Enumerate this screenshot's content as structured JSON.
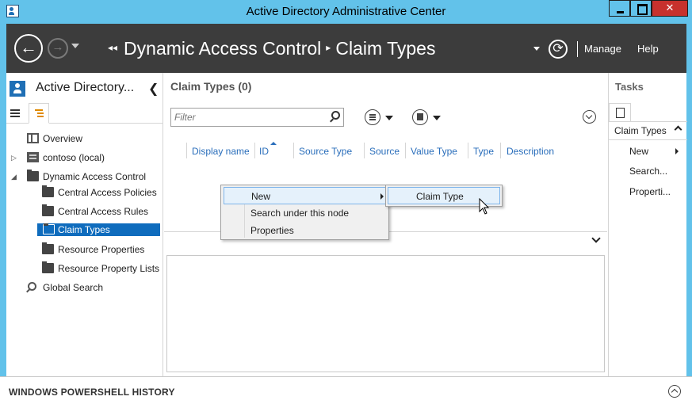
{
  "window": {
    "title": "Active Directory Administrative Center"
  },
  "header": {
    "breadcrumb": [
      "Dynamic Access Control",
      "Claim Types"
    ],
    "manage_label": "Manage",
    "help_label": "Help",
    "icons": [
      "back-arrow-icon",
      "forward-arrow-icon",
      "refresh-icon"
    ]
  },
  "left_nav": {
    "title": "Active Directory...",
    "tree": [
      {
        "label": "Overview",
        "icon": "overview-icon"
      },
      {
        "label": "contoso (local)",
        "icon": "server-icon",
        "expander": "▷"
      },
      {
        "label": "Dynamic Access Control",
        "icon": "folder-icon",
        "expander": "◢"
      },
      {
        "label": "Central Access Policies",
        "icon": "folder-icon"
      },
      {
        "label": "Central Access Rules",
        "icon": "folder-icon"
      },
      {
        "label": "Claim Types",
        "icon": "folder-icon",
        "selected": true
      },
      {
        "label": "Resource Properties",
        "icon": "folder-icon"
      },
      {
        "label": "Resource Property Lists",
        "icon": "folder-icon"
      },
      {
        "label": "Global Search",
        "icon": "search-icon"
      }
    ]
  },
  "center": {
    "title": "Claim Types  (0)",
    "filter_placeholder": "Filter",
    "columns": [
      "Display name",
      "ID",
      "Source Type",
      "Source",
      "Value Type",
      "Type",
      "Description"
    ]
  },
  "context_menu": {
    "items": [
      "New",
      "Search under this node",
      "Properties"
    ],
    "submenu": [
      "Claim Type"
    ]
  },
  "tasks": {
    "title": "Tasks",
    "group": "Claim Types",
    "items": [
      "New",
      "Search...",
      "Properti..."
    ]
  },
  "powershell": {
    "label": "WINDOWS POWERSHELL HISTORY"
  },
  "colors": {
    "titlebar": "#62c2ea",
    "header": "#3c3c3c",
    "selection": "#0f6cbd",
    "link": "#2a6ebb",
    "close_button": "#c7312d"
  }
}
